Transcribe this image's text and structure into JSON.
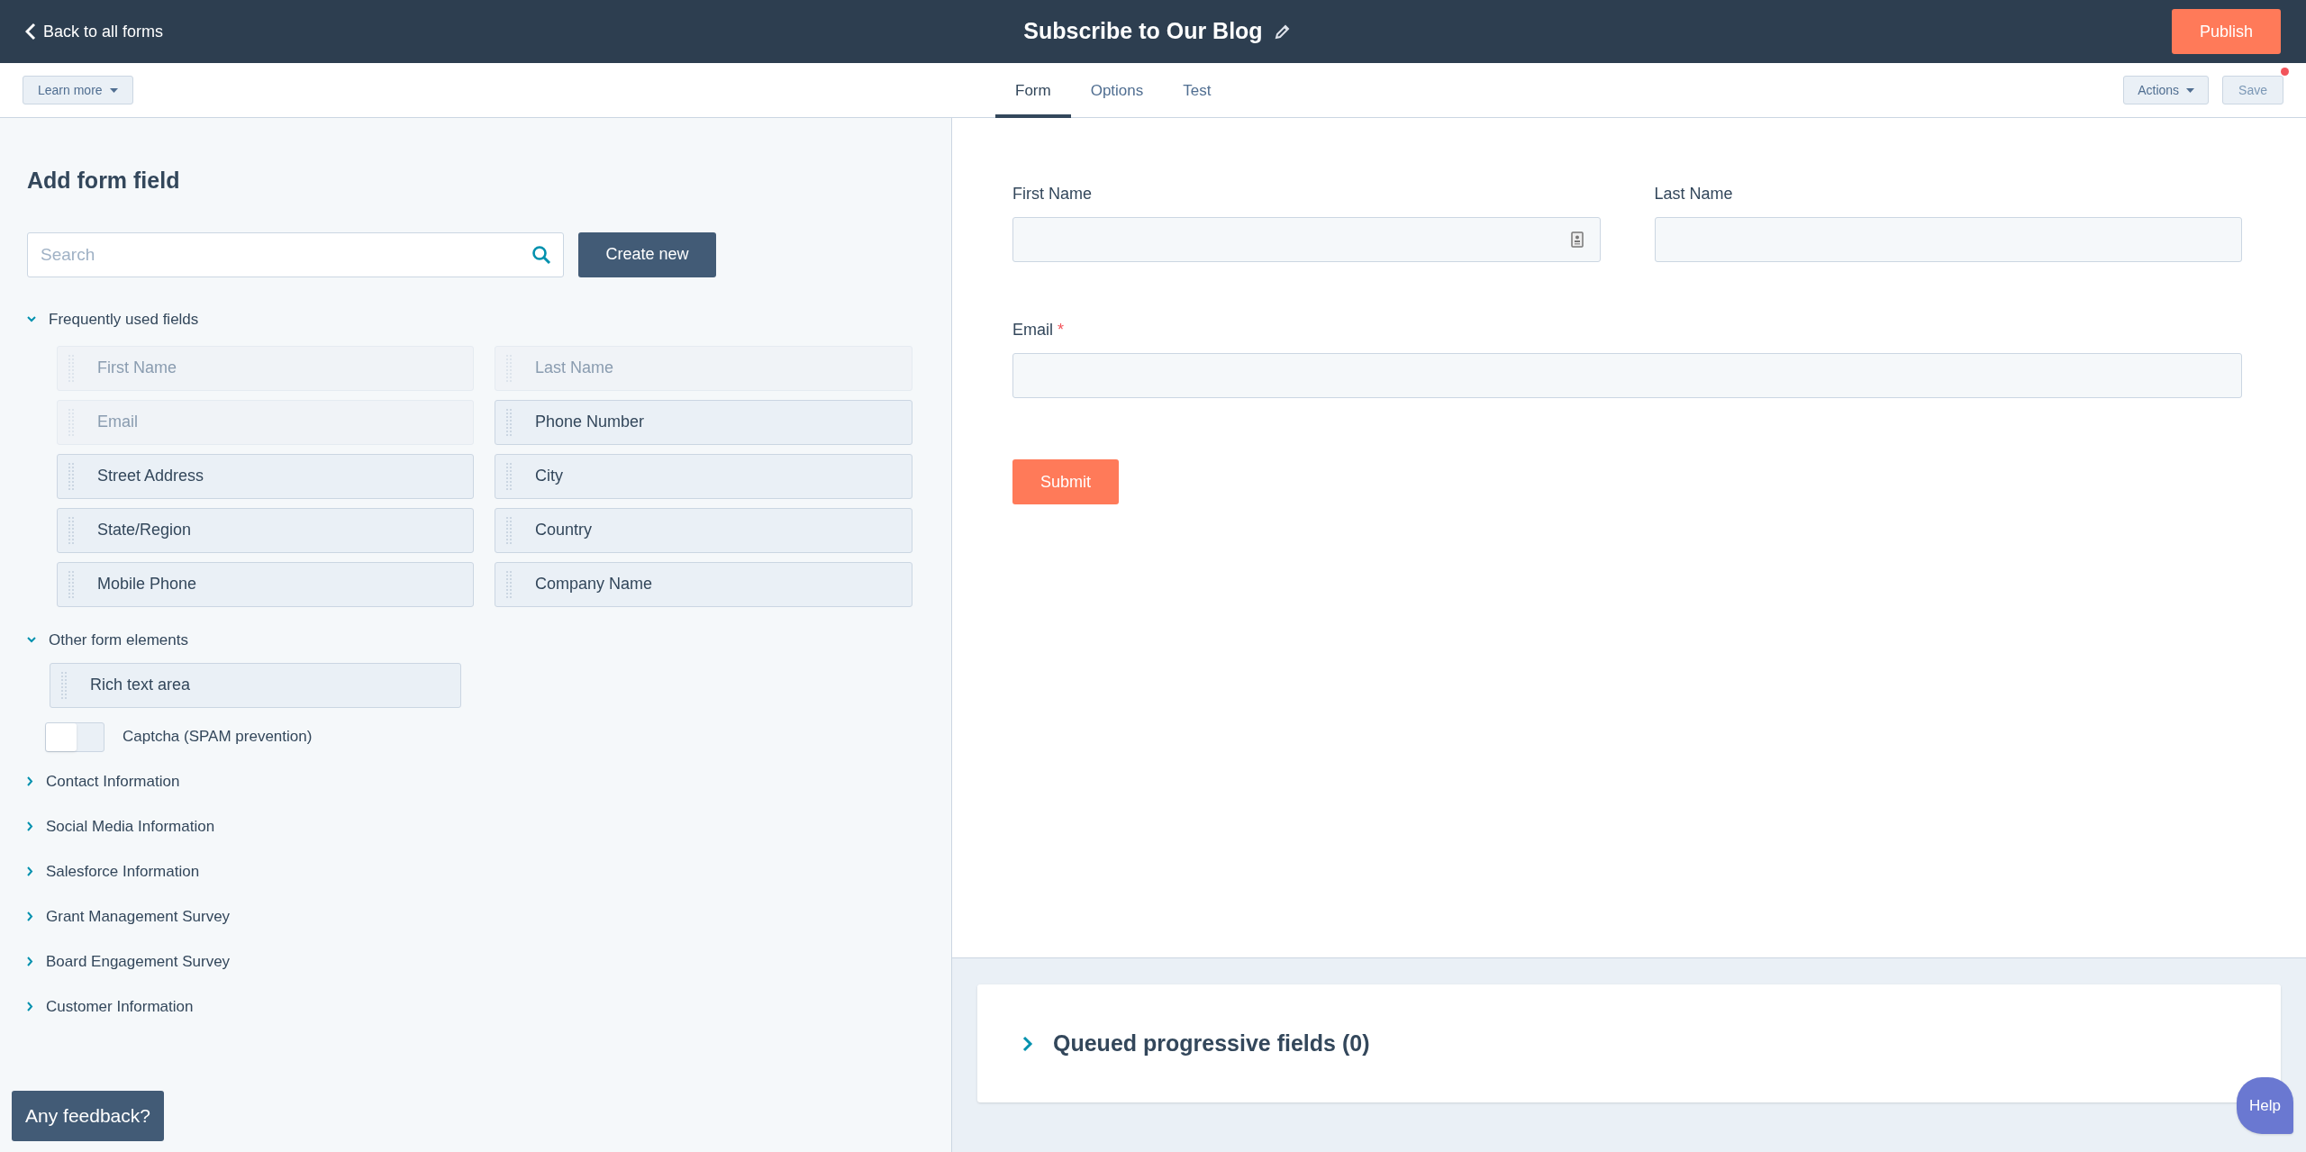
{
  "header": {
    "back": "Back to all forms",
    "title": "Subscribe to Our Blog",
    "publish": "Publish"
  },
  "subbar": {
    "learn_more": "Learn more",
    "tabs": [
      {
        "label": "Form",
        "selected": true
      },
      {
        "label": "Options",
        "selected": false
      },
      {
        "label": "Test",
        "selected": false
      }
    ],
    "actions": "Actions",
    "save": "Save",
    "unsaved": true
  },
  "sidebar": {
    "title": "Add form field",
    "search": {
      "placeholder": "Search"
    },
    "create": "Create new",
    "sections": [
      {
        "label": "Frequently used fields",
        "expanded": true,
        "kind": "grid",
        "items": [
          {
            "label": "First Name",
            "disabled": true
          },
          {
            "label": "Last Name",
            "disabled": true
          },
          {
            "label": "Email",
            "disabled": true
          },
          {
            "label": "Phone Number",
            "disabled": false
          },
          {
            "label": "Street Address",
            "disabled": false
          },
          {
            "label": "City",
            "disabled": false
          },
          {
            "label": "State/Region",
            "disabled": false
          },
          {
            "label": "Country",
            "disabled": false
          },
          {
            "label": "Mobile Phone",
            "disabled": false
          },
          {
            "label": "Company Name",
            "disabled": false
          }
        ]
      },
      {
        "label": "Other form elements",
        "expanded": true,
        "kind": "elements",
        "items": [
          {
            "label": "Rich text area",
            "disabled": false
          }
        ],
        "toggle": {
          "label": "Captcha (SPAM prevention)",
          "on": false
        }
      },
      {
        "label": "Contact Information",
        "expanded": false
      },
      {
        "label": "Social Media Information",
        "expanded": false
      },
      {
        "label": "Salesforce Information",
        "expanded": false
      },
      {
        "label": "Grant Management Survey",
        "expanded": false
      },
      {
        "label": "Board Engagement Survey",
        "expanded": false
      },
      {
        "label": "Customer Information",
        "expanded": false
      }
    ],
    "feedback": "Any feedback?"
  },
  "form": {
    "rows": [
      [
        {
          "label": "First Name",
          "required": false,
          "contact_icon": true
        },
        {
          "label": "Last Name",
          "required": false,
          "contact_icon": false
        }
      ],
      [
        {
          "label": "Email",
          "required": true,
          "contact_icon": false
        }
      ]
    ],
    "required_mark": "*",
    "submit": "Submit"
  },
  "queued": {
    "label": "Queued progressive fields (0)",
    "expanded": false
  },
  "help": "Help"
}
